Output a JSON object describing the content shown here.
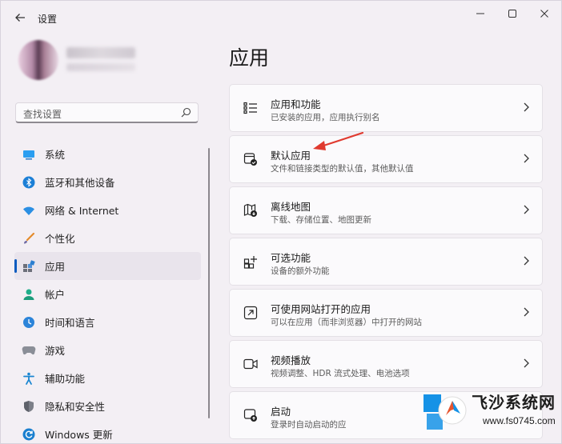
{
  "window": {
    "title": "设置",
    "controls": [
      "minimize-icon",
      "maximize-icon",
      "close-icon"
    ]
  },
  "search": {
    "placeholder": "查找设置"
  },
  "nav": [
    {
      "label": "系统",
      "icon": "system-icon"
    },
    {
      "label": "蓝牙和其他设备",
      "icon": "bluetooth-icon"
    },
    {
      "label": "网络 & Internet",
      "icon": "network-icon"
    },
    {
      "label": "个性化",
      "icon": "personalization-icon"
    },
    {
      "label": "应用",
      "icon": "apps-icon",
      "active": true
    },
    {
      "label": "帐户",
      "icon": "account-icon"
    },
    {
      "label": "时间和语言",
      "icon": "time-language-icon"
    },
    {
      "label": "游戏",
      "icon": "gaming-icon"
    },
    {
      "label": "辅助功能",
      "icon": "accessibility-icon"
    },
    {
      "label": "隐私和安全性",
      "icon": "privacy-icon"
    },
    {
      "label": "Windows 更新",
      "icon": "windows-update-icon"
    }
  ],
  "main": {
    "title": "应用",
    "cards": [
      {
        "title": "应用和功能",
        "desc": "已安装的应用，应用执行别名",
        "icon": "apps-features-icon"
      },
      {
        "title": "默认应用",
        "desc": "文件和链接类型的默认值，其他默认值",
        "icon": "default-apps-icon"
      },
      {
        "title": "离线地图",
        "desc": "下载、存储位置、地图更新",
        "icon": "offline-maps-icon"
      },
      {
        "title": "可选功能",
        "desc": "设备的额外功能",
        "icon": "optional-features-icon"
      },
      {
        "title": "可使用网站打开的应用",
        "desc": "可以在应用（而非浏览器）中打开的网站",
        "icon": "apps-for-websites-icon"
      },
      {
        "title": "视频播放",
        "desc": "视频调整、HDR 流式处理、电池选项",
        "icon": "video-playback-icon"
      },
      {
        "title": "启动",
        "desc": "登录时自动启动的应",
        "icon": "startup-icon"
      }
    ]
  },
  "watermark": {
    "name": "飞沙系统网",
    "url": "www.fs0745.com"
  },
  "colors": {
    "accent": "#0a5bbf",
    "annotation": "#e03a2f",
    "background": "#f3eff4",
    "card": "#fbfafc"
  }
}
